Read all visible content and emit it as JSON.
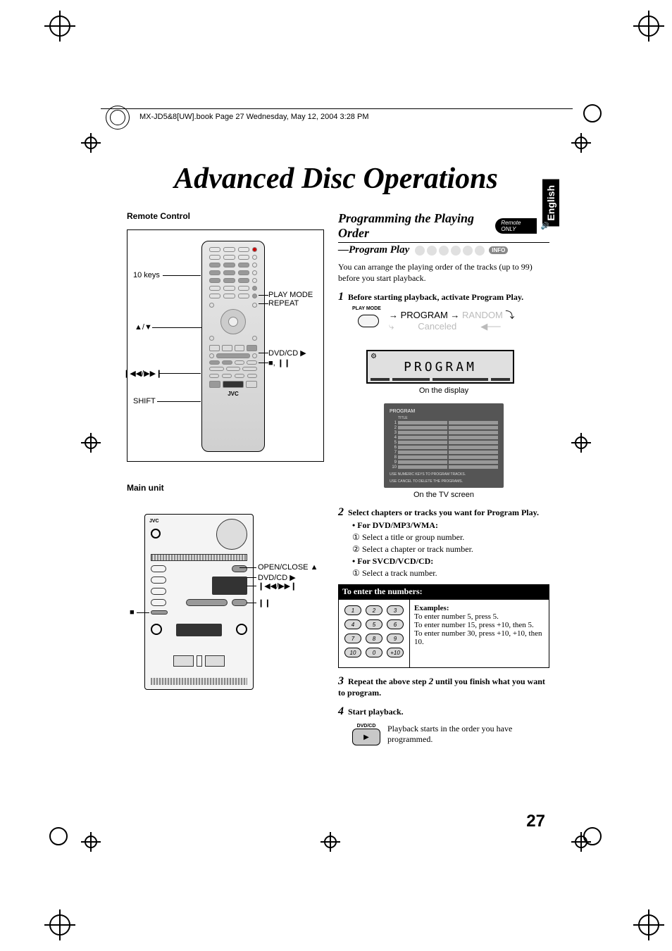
{
  "header": "MX-JD5&8[UW].book  Page 27  Wednesday, May 12, 2004  3:28 PM",
  "title": "Advanced Disc Operations",
  "language_tab": "English",
  "left": {
    "remote_label": "Remote Control",
    "main_unit_label": "Main unit",
    "annotations": {
      "ten_keys": "10 keys",
      "play_mode": "PLAY MODE",
      "repeat": "REPEAT",
      "up_down": "▲/▼",
      "dvd_cd": "DVD/CD ▶",
      "stop_pause": "■, ❙❙",
      "prev_next": "❙◀◀/▶▶❙",
      "shift": "SHIFT",
      "brand": "JVC",
      "open_close": "OPEN/CLOSE ▲",
      "main_dvd_cd": "DVD/CD ▶",
      "main_prev_next": "❙◀◀/▶▶❙",
      "main_pause": "❙❙",
      "main_stop": "■"
    }
  },
  "right": {
    "heading": "Programming the Playing Order",
    "remote_only": "Remote ONLY",
    "subheading": "—Program Play",
    "info_badge": "INFO",
    "intro": "You can arrange the playing order of the tracks (up to 99) before you start playback.",
    "step1": "Before starting playback, activate Program Play.",
    "mode": {
      "button": "PLAY MODE",
      "program": "PROGRAM",
      "random": "RANDOM",
      "canceled": "Canceled"
    },
    "display_text": "PROGRAM",
    "display_caption": "On the display",
    "tv": {
      "title": "PROGRAM",
      "col1": "TITLE",
      "col2": "",
      "hint1": "USE NUMERIC KEYS TO PROGRAM TRACKS.",
      "hint2": "USE CANCEL TO DELETE THE PROGRAMS."
    },
    "tv_caption": "On the TV screen",
    "step2": "Select chapters or tracks you want for Program Play.",
    "step2a": "• For DVD/MP3/WMA:",
    "step2a1": "Select a title or group number.",
    "step2a2": "Select a chapter or track number.",
    "step2b": "• For SVCD/VCD/CD:",
    "step2b1": "Select a track number.",
    "number_header": "To enter the numbers:",
    "keys": [
      "1",
      "2",
      "3",
      "4",
      "5",
      "6",
      "7",
      "8",
      "9",
      "10",
      "0",
      "+10"
    ],
    "examples_label": "Examples:",
    "example1": "To enter number 5, press 5.",
    "example2": "To enter number 15, press +10, then 5.",
    "example3": "To enter number 30, press +10, +10, then 10.",
    "step3_a": "Repeat the above step ",
    "step3_b": " until you finish what you want to program.",
    "step4": "Start playback.",
    "play_btn_label": "DVD/CD",
    "play_desc": "Playback starts in the order you have programmed."
  },
  "page_number": "27"
}
